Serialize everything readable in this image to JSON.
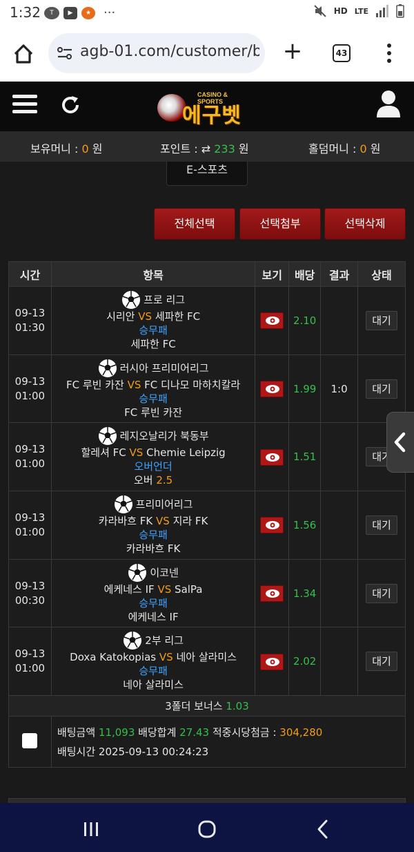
{
  "status_bar": {
    "time": "1:32",
    "notif_icons": [
      "talk-icon",
      "youtube-icon",
      "app-icon",
      "more-dots-icon"
    ],
    "right_icons": [
      "mute-icon",
      "hd-voice-icon",
      "lte-icon",
      "signal-icon",
      "battery-icon"
    ],
    "hd_label": "HD",
    "lte_label": "LTE"
  },
  "browser": {
    "url": "agb-01.com/customer/b",
    "tab_count": "43"
  },
  "site": {
    "logo_small": "CASINO & SPORTS",
    "logo_big": "에구벳"
  },
  "balances": {
    "holding_label": "보유머니 : ",
    "holding_value": "0",
    "holding_unit": " 원",
    "points_label": "포인트 : ",
    "points_value": "233",
    "points_unit": " 원",
    "holdem_label": "홀덤머니 : ",
    "holdem_value": "0",
    "holdem_unit": " 원"
  },
  "esports_tab": "E-스포츠",
  "actions": {
    "select_all": "전체선택",
    "attach_selected": "선택첨부",
    "delete_selected": "선택삭제"
  },
  "table": {
    "headers": [
      "시간",
      "항목",
      "보기",
      "배당",
      "결과",
      "상태"
    ],
    "rows": [
      {
        "date": "09-13",
        "time": "01:30",
        "league": "프로 리그",
        "home": "시리안",
        "vs": "VS",
        "away": "세파한 FC",
        "market": "승무패",
        "pick": "세파한 FC",
        "pick_extra": "",
        "odds": "2.10",
        "result": "",
        "status": "대기"
      },
      {
        "date": "09-13",
        "time": "01:00",
        "league": "러시아 프리미어리그",
        "home": "FC 루빈 카잔",
        "vs": "VS",
        "away": "FC 디나모 마하치칼라",
        "market": "승무패",
        "pick": "FC 루빈 카잔",
        "pick_extra": "",
        "odds": "1.99",
        "result": "1:0",
        "status": "대기"
      },
      {
        "date": "09-13",
        "time": "01:00",
        "league": "레지오날리가 북동부",
        "home": "할레셔 FC",
        "vs": "VS",
        "away": "Chemie Leipzig",
        "market": "오버언더",
        "pick": "오버 ",
        "pick_extra": "2.5",
        "odds": "1.51",
        "result": "",
        "status": "대기"
      },
      {
        "date": "09-13",
        "time": "01:00",
        "league": "프리미어리그",
        "home": "카라바흐 FK",
        "vs": "VS",
        "away": "지라 FK",
        "market": "승무패",
        "pick": "카라바흐 FK",
        "pick_extra": "",
        "odds": "1.56",
        "result": "",
        "status": "대기"
      },
      {
        "date": "09-13",
        "time": "00:30",
        "league": "이코넨",
        "home": "에케네스 IF",
        "vs": "VS",
        "away": "SalPa",
        "market": "승무패",
        "pick": "에케네스 IF",
        "pick_extra": "",
        "odds": "1.34",
        "result": "",
        "status": "대기"
      },
      {
        "date": "09-13",
        "time": "01:00",
        "league": "2부 리그",
        "home": "Doxa Katokopias",
        "vs": "VS",
        "away": "네아 살라미스",
        "market": "승무패",
        "pick": "네아 살라미스",
        "pick_extra": "",
        "odds": "2.02",
        "result": "",
        "status": "대기"
      }
    ],
    "bonus_label": "3폴더 보너스 ",
    "bonus_value": "1.03",
    "summary": {
      "bet_amount_label": "배팅금액 ",
      "bet_amount": "11,093",
      "odds_sum_label": " 배당합계 ",
      "odds_sum": "27.43",
      "payout_label": " 적중시당첨금 : ",
      "payout": "304,280",
      "bet_time_label": "배팅시간 ",
      "bet_time": "2025-09-13 00:24:23"
    }
  },
  "colors": {
    "accent_red": "#a31a1a",
    "odds_green": "#35c04a",
    "vs_orange": "#f39b1b",
    "market_blue": "#3ea3ff",
    "nav_bg": "#0e1442"
  }
}
